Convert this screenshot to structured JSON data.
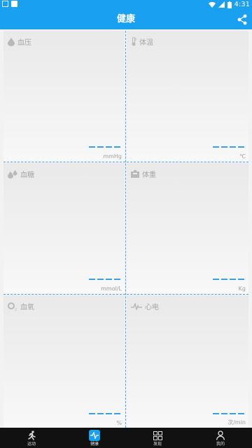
{
  "status_bar": {
    "time": "4:31"
  },
  "header": {
    "title": "健康",
    "share_icon": "share-icon"
  },
  "cells": [
    {
      "label": "血压",
      "unit": "mmHg",
      "icon": "blood-drop-icon"
    },
    {
      "label": "体温",
      "unit": "℃",
      "icon": "thermometer-icon"
    },
    {
      "label": "血糖",
      "unit": "mmol/L",
      "icon": "blood-sugar-icon"
    },
    {
      "label": "体重",
      "unit": "Kg",
      "icon": "scale-icon"
    },
    {
      "label": "血氧",
      "unit": "%",
      "icon": "oxygen-icon"
    },
    {
      "label": "心电",
      "unit": "次/min",
      "icon": "ecg-icon"
    }
  ],
  "tabs": [
    {
      "label": "运动",
      "icon": "running-icon"
    },
    {
      "label": "健康",
      "icon": "health-icon",
      "active": true
    },
    {
      "label": "发现",
      "icon": "grid-icon"
    },
    {
      "label": "我的",
      "icon": "user-icon"
    }
  ],
  "colors": {
    "accent": "#1aa0f0",
    "divider": "#4aa7e8",
    "bottom_bar": "#111111"
  }
}
